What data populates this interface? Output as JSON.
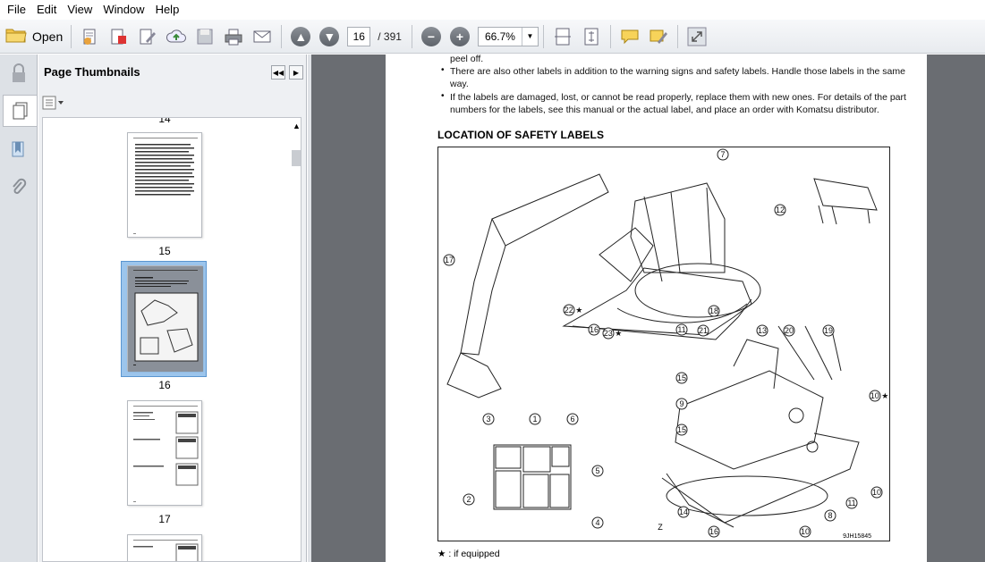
{
  "menu": [
    "File",
    "Edit",
    "View",
    "Window",
    "Help"
  ],
  "toolbar": {
    "open_label": "Open",
    "page_current": "16",
    "page_total": "/ 391",
    "zoom": "66.7%"
  },
  "panel": {
    "title": "Page Thumbnails",
    "thumbs": [
      {
        "label": "14"
      },
      {
        "label": "15"
      },
      {
        "label": "16"
      },
      {
        "label": "17"
      }
    ]
  },
  "document": {
    "line0": "peel off.",
    "bullet1_line1": "There are also other labels in addition to the warning signs and safety labels. Handle those labels in the same",
    "bullet1_line2": "way.",
    "bullet2_line1": "If the labels are damaged, lost, or cannot be read properly, replace them with new ones. For details of the part",
    "bullet2_line2": "numbers for the labels, see this manual or the actual label, and place an order with Komatsu distributor.",
    "heading": "LOCATION OF SAFETY LABELS",
    "figure_code": "9JH15845",
    "figure_view_label": "Z",
    "footnote": "★ : if equipped",
    "callouts": [
      "7",
      "18",
      "12",
      "17",
      "22 ★",
      "23 ★",
      "11",
      "16",
      "21",
      "13",
      "20",
      "19",
      "15",
      "9",
      "10 ★",
      "15",
      "14",
      "16",
      "10",
      "8",
      "11",
      "10",
      "3",
      "1",
      "6",
      "5",
      "2",
      "4"
    ]
  },
  "colors": {
    "toolbar_bg": "#eceef1",
    "selection": "#9cc5ec",
    "doc_bg": "#6a6d72"
  }
}
